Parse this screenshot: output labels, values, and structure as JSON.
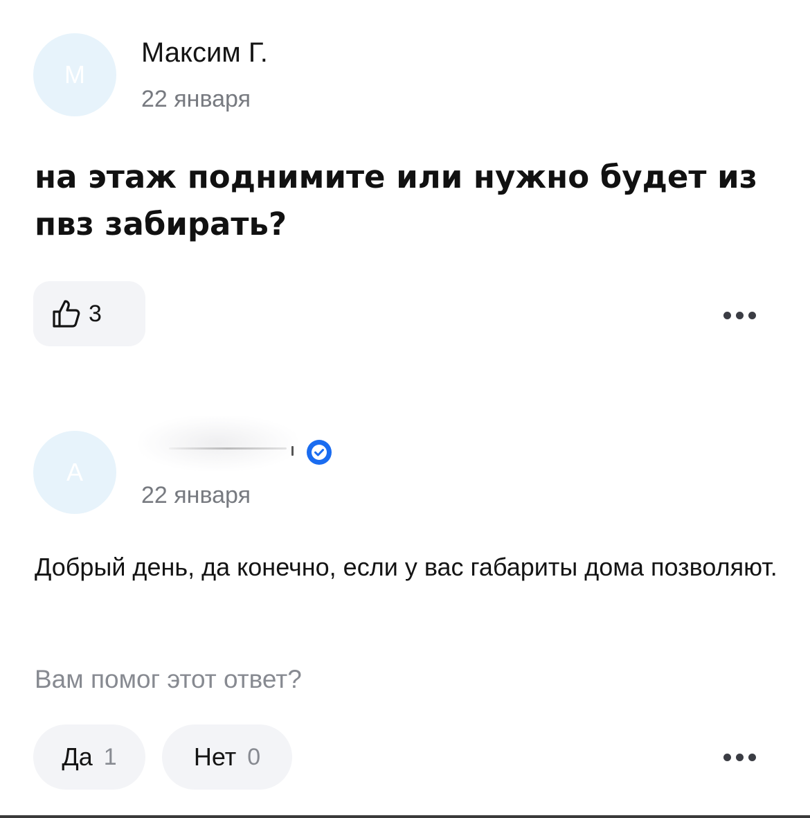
{
  "question_post": {
    "avatar_letter": "М",
    "author": "Максим Г.",
    "date": "22 января",
    "text": "на этаж поднимите или нужно будет из пвз забирать?",
    "likes": "3",
    "more_icon": "more-dots-icon"
  },
  "answer_post": {
    "avatar_letter": "А",
    "author_hidden": true,
    "verified_icon": "verified-check-icon",
    "date": "22 января",
    "text": "Добрый день, да конечно, если у вас габариты дома позволяют.",
    "helpful_question": "Вам помог этот ответ?",
    "yes_label": "Да",
    "yes_count": "1",
    "no_label": "Нет",
    "no_count": "0",
    "more_icon": "more-dots-icon"
  },
  "colors": {
    "avatar_bg": "#e7f3fb",
    "pill_bg": "#f3f4f7",
    "muted_text": "#878a91",
    "verified_blue": "#1a6cf0"
  }
}
